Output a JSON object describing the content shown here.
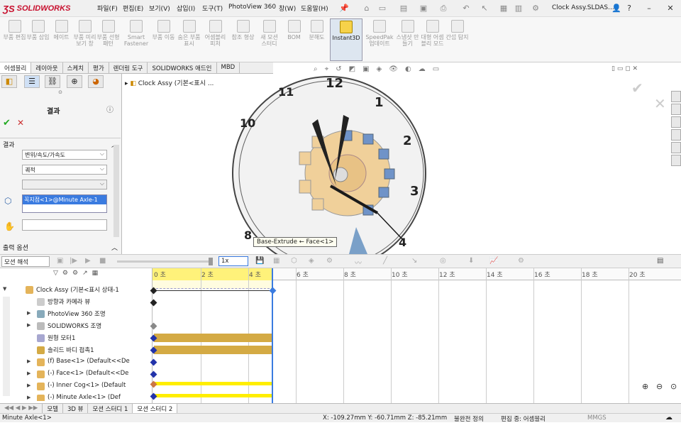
{
  "app": {
    "logo": "SOLIDWORKS",
    "doc_title": "Clock Assy.SLDAS..."
  },
  "menu": [
    "파일(F)",
    "편집(E)",
    "보기(V)",
    "삽입(I)",
    "도구(T)",
    "PhotoView 360",
    "창(W)",
    "도움말(H)"
  ],
  "commands": [
    "부품 편집",
    "부품 삽입",
    "메이트",
    "부품 미리보기 창",
    "부품 선형 패턴",
    "Smart Fastener",
    "부품 이동",
    "숨은 부품 표시",
    "어셈블리 피처",
    "참조 형상",
    "새 모션 스터디",
    "BOM",
    "분해도",
    "Instant3D",
    "SpeedPak 업데이트",
    "스냅샷 만들기",
    "대형 어셈블리 모드",
    "간섭 탐지"
  ],
  "tabs": [
    "어셈블리",
    "레이아웃",
    "스케치",
    "평가",
    "렌더링 도구",
    "SOLIDWORKS 애드인",
    "MBD"
  ],
  "panel": {
    "title": "결과",
    "section": "결과",
    "dd1": "변위/속도/가속도",
    "dd2": "궤적",
    "field1": "꼭지점<1>@Minute Axle-1",
    "output_label": "출력 옵션"
  },
  "viewport": {
    "tree_label": "Clock Assy (기본<표시 ...",
    "tooltip": "Base-Extrude ← Face<1>",
    "clock_numbers": [
      "12",
      "1",
      "2",
      "3",
      "4",
      "8",
      "10",
      "11"
    ]
  },
  "motion": {
    "type": "모션 해석",
    "speed": "1x"
  },
  "timeline": {
    "ticks": [
      "0 초",
      "2 초",
      "4 초",
      "6 초",
      "8 초",
      "10 초",
      "12 초",
      "14 초",
      "16 초",
      "18 초",
      "20 초"
    ]
  },
  "tree": [
    {
      "label": "Clock Assy (기본<표시 상태-1"
    },
    {
      "label": "방향과 카메라 뷰"
    },
    {
      "label": "PhotoView 360 조명"
    },
    {
      "label": "SOLIDWORKS 조명"
    },
    {
      "label": "원형 모터1"
    },
    {
      "label": "솔리드 바디 접촉1"
    },
    {
      "label": "(f) Base<1> (Default<<De"
    },
    {
      "label": "(-) Face<1> (Default<<De"
    },
    {
      "label": "(-) Inner Cog<1> (Default"
    },
    {
      "label": "(-) Minute Axle<1> (Def"
    }
  ],
  "bottom_tabs": [
    "모델",
    "3D 뷰",
    "모션 스터디 1",
    "모션 스터디 2"
  ],
  "status": {
    "left": "Minute Axle<1>",
    "coords": "X: -109.27mm Y: -60.71mm Z: -85.21mm",
    "state": "불완전 정의",
    "edit": "편집 중: 어셈블리",
    "units": "MMGS"
  }
}
